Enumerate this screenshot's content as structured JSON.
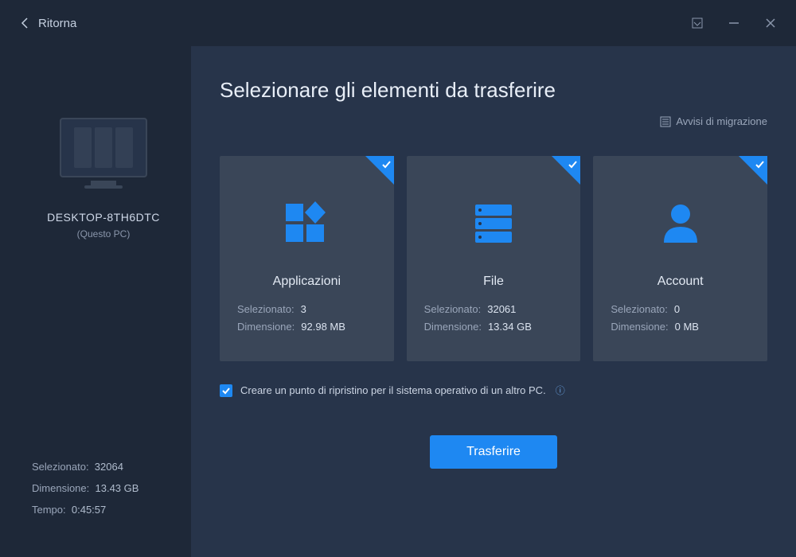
{
  "titlebar": {
    "back_label": "Ritorna"
  },
  "sidebar": {
    "pc_name": "DESKTOP-8TH6DTC",
    "pc_sub": "(Questo PC)",
    "stats": {
      "selected_label": "Selezionato:",
      "selected_value": "32064",
      "size_label": "Dimensione:",
      "size_value": "13.43 GB",
      "time_label": "Tempo:",
      "time_value": "0:45:57"
    }
  },
  "main": {
    "title": "Selezionare gli elementi da trasferire",
    "migration_notice": "Avvisi di migrazione",
    "cards": [
      {
        "title": "Applicazioni",
        "selected_label": "Selezionato:",
        "selected_value": "3",
        "size_label": "Dimensione:",
        "size_value": "92.98 MB",
        "icon": "apps"
      },
      {
        "title": "File",
        "selected_label": "Selezionato:",
        "selected_value": "32061",
        "size_label": "Dimensione:",
        "size_value": "13.34 GB",
        "icon": "files"
      },
      {
        "title": "Account",
        "selected_label": "Selezionato:",
        "selected_value": "0",
        "size_label": "Dimensione:",
        "size_value": "0 MB",
        "icon": "account"
      }
    ],
    "restore_checkbox_label": "Creare un punto di ripristino per il sistema operativo di un altro PC.",
    "restore_checked": true,
    "transfer_button": "Trasferire"
  }
}
